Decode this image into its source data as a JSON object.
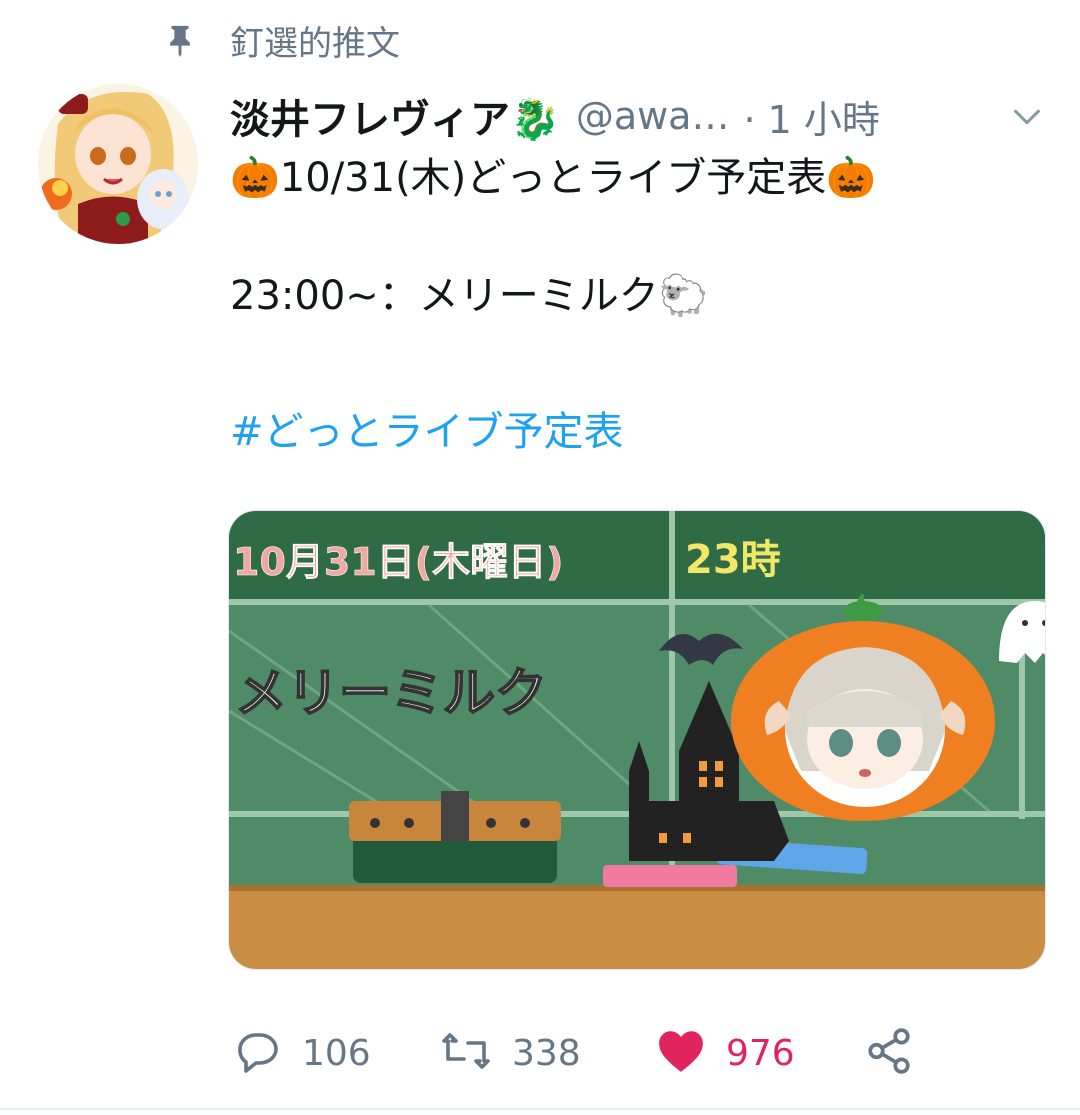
{
  "pinned": {
    "label": "釘選的推文",
    "icon": "pin-icon"
  },
  "tweet": {
    "author_name": "淡井フレヴィア🐉",
    "handle": "@awa…",
    "time": "· 1 小時",
    "lines": [
      "🎃10/31(木)どっとライブ予定表🎃",
      "",
      " 23:00~：メリーミルク🐑",
      "",
      "#どっとライブ予定表"
    ]
  },
  "media": {
    "date_text": "10月31日(木曜日)",
    "time_text": "23時",
    "title_text": "メリーミルク"
  },
  "actions": {
    "reply_count": "106",
    "retweet_count": "338",
    "like_count": "976"
  },
  "colors": {
    "link": "#1da1f2",
    "like": "#e0245e",
    "muted": "#657786"
  }
}
